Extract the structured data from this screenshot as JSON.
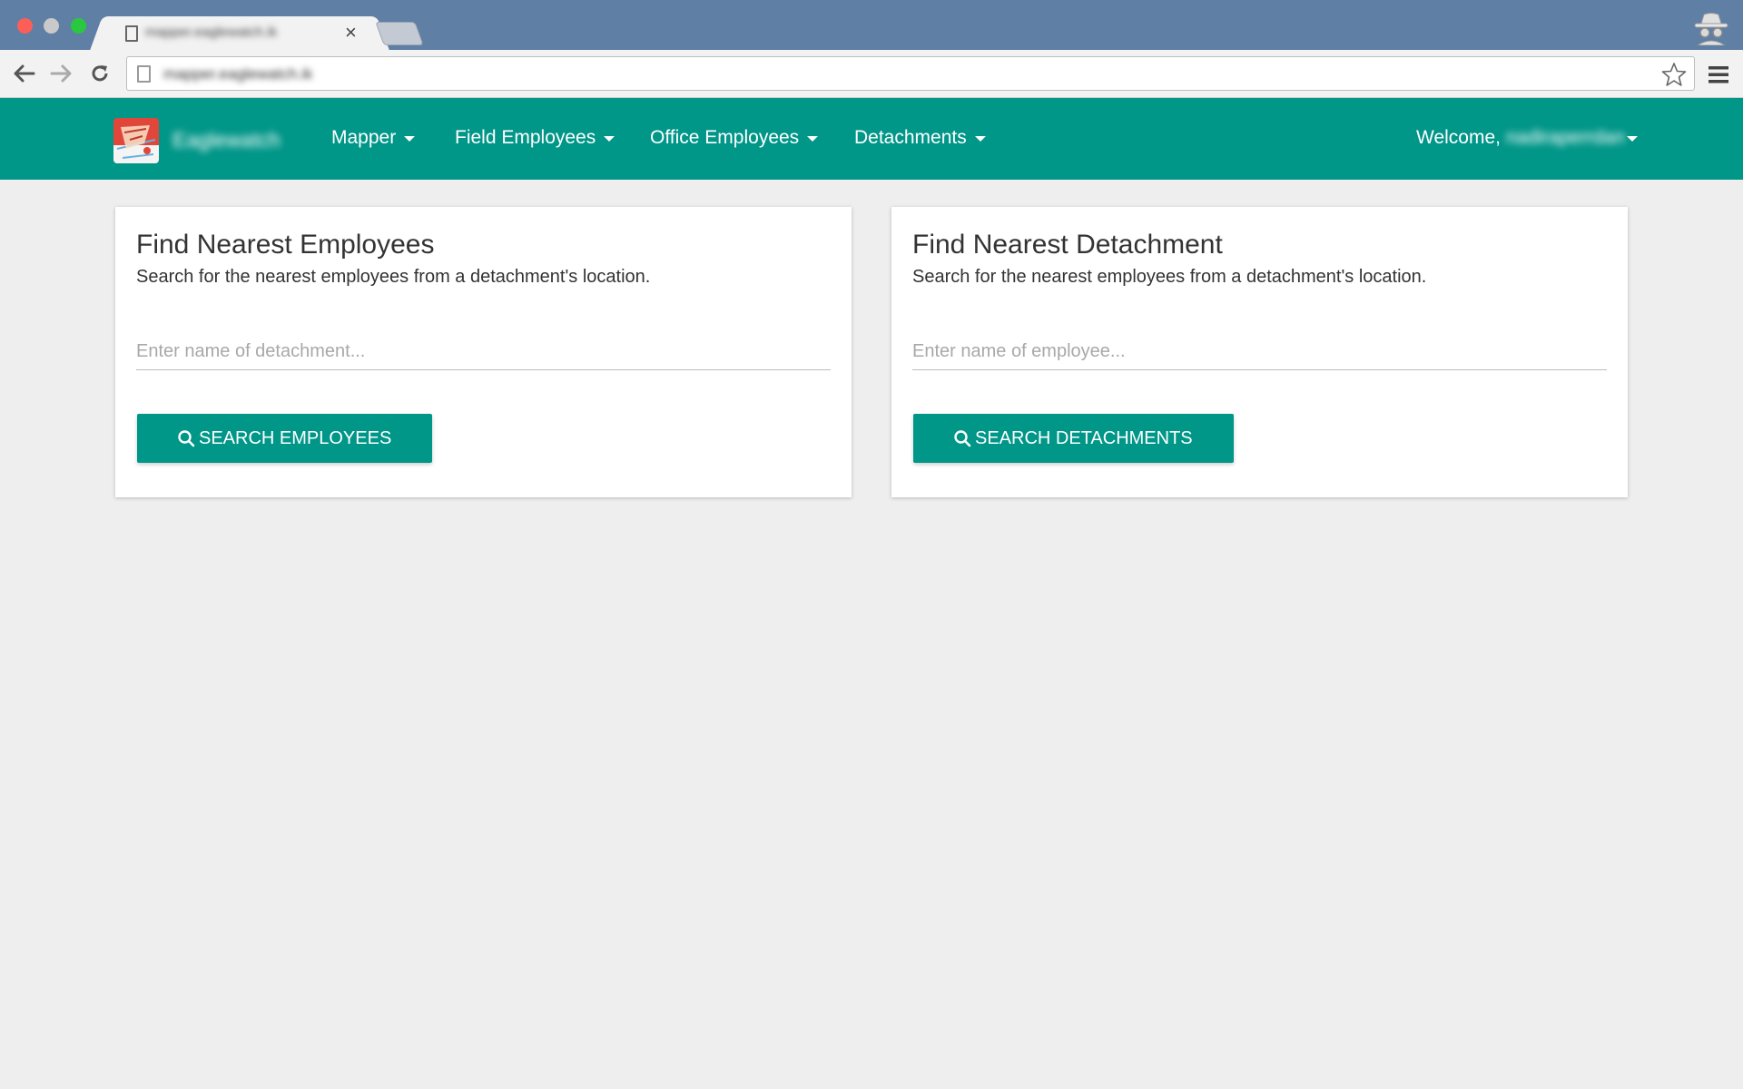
{
  "browser": {
    "tab_title": "mapper.eaglewatch.ik",
    "tab_close_glyph": "×",
    "url": "mapper.eaglewatch.ik",
    "icons": [
      "back-arrow-icon",
      "forward-arrow-icon",
      "reload-icon",
      "page-icon",
      "star-icon",
      "hamburger-menu-icon",
      "incognito-icon"
    ]
  },
  "navbar": {
    "brand_name": "Eaglewatch",
    "items": [
      {
        "label": "Mapper"
      },
      {
        "label": "Field Employees"
      },
      {
        "label": "Office Employees"
      },
      {
        "label": "Detachments"
      }
    ],
    "welcome_label": "Welcome,",
    "username": "nadiraperrdan"
  },
  "cards": [
    {
      "title": "Find Nearest Employees",
      "description": "Search for the nearest employees from a detachment's location.",
      "input_placeholder": "Enter name of detachment...",
      "input_value": "",
      "button_label": "SEARCH EMPLOYEES"
    },
    {
      "title": "Find Nearest Detachment",
      "description": "Search for the nearest employees from a detachment's location.",
      "input_placeholder": "Enter name of employee...",
      "input_value": "",
      "button_label": "SEARCH DETACHMENTS"
    }
  ],
  "colors": {
    "primary": "#009688",
    "page_background": "#eeeeee",
    "browser_frame": "#5f7fa4",
    "card_background": "#ffffff"
  }
}
